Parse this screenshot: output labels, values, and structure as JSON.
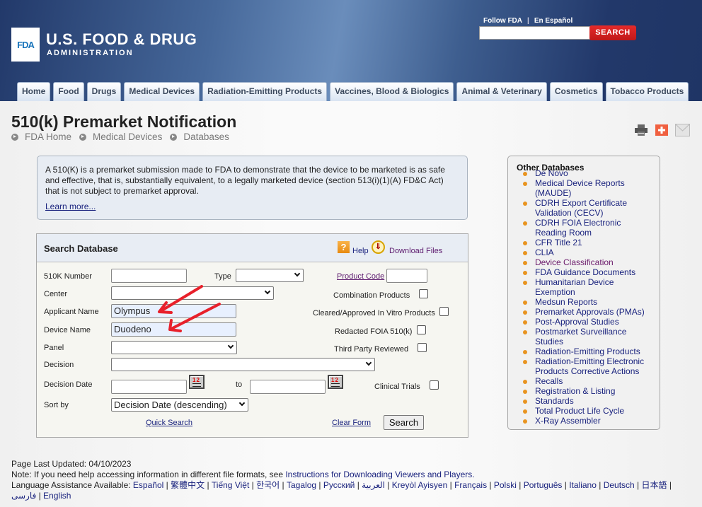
{
  "header": {
    "logo_mark": "FDA",
    "logo_title": "U.S. FOOD & DRUG",
    "logo_subtitle": "ADMINISTRATION",
    "top_links": [
      "Follow FDA",
      "En Español"
    ],
    "search_placeholder": "",
    "search_button": "SEARCH"
  },
  "nav_tabs": [
    "Home",
    "Food",
    "Drugs",
    "Medical Devices",
    "Radiation-Emitting Products",
    "Vaccines, Blood & Biologics",
    "Animal & Veterinary",
    "Cosmetics",
    "Tobacco Products"
  ],
  "page": {
    "title": "510(k) Premarket Notification",
    "breadcrumb": [
      "FDA Home",
      "Medical Devices",
      "Databases"
    ],
    "utility_icons": [
      "print-icon",
      "add-share-icon",
      "email-icon"
    ]
  },
  "intro": {
    "text": "A 510(K) is a premarket submission made to FDA to demonstrate that the device to be marketed is as safe and effective, that is, substantially equivalent, to a legally marketed device (section 513(i)(1)(A) FD&C Act) that is not subject to premarket approval.",
    "learn_more": "Learn more..."
  },
  "search_form": {
    "title": "Search Database",
    "help": "Help",
    "download": "Download Files",
    "labels": {
      "number": "510K Number",
      "type": "Type",
      "product_code": "Product Code",
      "center": "Center",
      "combination": "Combination Products",
      "applicant": "Applicant Name",
      "in_vitro": "Cleared/Approved In Vitro Products",
      "device": "Device Name",
      "redacted": "Redacted FOIA 510(k)",
      "panel": "Panel",
      "third_party": "Third Party Reviewed",
      "decision": "Decision",
      "decision_date": "Decision Date",
      "to": "to",
      "clinical": "Clinical Trials",
      "sort_by": "Sort by"
    },
    "values": {
      "number": "",
      "type": "",
      "product_code": "",
      "center": "",
      "applicant": "Olympus",
      "device": "Duodeno",
      "panel": "",
      "decision": "",
      "date_from": "",
      "date_to": "",
      "sort_by": "Decision Date (descending)"
    },
    "checkboxes": {
      "combination": false,
      "in_vitro": false,
      "redacted": false,
      "third_party": false,
      "clinical": false
    },
    "quick_search": "Quick Search",
    "clear_form": "Clear Form",
    "search_button": "Search"
  },
  "other_databases": {
    "title": "Other Databases",
    "items": [
      {
        "label": "De Novo",
        "visited": false
      },
      {
        "label": "Medical Device Reports (MAUDE)",
        "visited": false
      },
      {
        "label": "CDRH Export Certificate Validation (CECV)",
        "visited": false
      },
      {
        "label": "CDRH FOIA Electronic Reading Room",
        "visited": false
      },
      {
        "label": "CFR Title 21",
        "visited": false
      },
      {
        "label": "CLIA",
        "visited": false
      },
      {
        "label": "Device Classification",
        "visited": true
      },
      {
        "label": "FDA Guidance Documents",
        "visited": false
      },
      {
        "label": "Humanitarian Device Exemption",
        "visited": false
      },
      {
        "label": "Medsun Reports",
        "visited": false
      },
      {
        "label": "Premarket Approvals (PMAs)",
        "visited": false
      },
      {
        "label": "Post-Approval Studies",
        "visited": false
      },
      {
        "label": "Postmarket Surveillance Studies",
        "visited": false
      },
      {
        "label": "Radiation-Emitting Products",
        "visited": false
      },
      {
        "label": "Radiation-Emitting Electronic Products Corrective Actions",
        "visited": false
      },
      {
        "label": "Recalls",
        "visited": false
      },
      {
        "label": "Registration & Listing",
        "visited": false
      },
      {
        "label": "Standards",
        "visited": false
      },
      {
        "label": "Total Product Life Cycle",
        "visited": false
      },
      {
        "label": "X-Ray Assembler",
        "visited": false
      }
    ]
  },
  "footer": {
    "updated": "Page Last Updated: 04/10/2023",
    "note_prefix": "Note: If you need help accessing information in different file formats, see ",
    "note_link": "Instructions for Downloading Viewers and Players.",
    "lang_prefix": "Language Assistance Available: ",
    "languages": [
      "Español",
      "繁體中文",
      "Tiếng Việt",
      "한국어",
      "Tagalog",
      "Русский",
      "العربية",
      "Kreyòl Ayisyen",
      "Français",
      "Polski",
      "Português",
      "Italiano",
      "Deutsch",
      "日本語",
      "فارسی",
      "English"
    ]
  },
  "colors": {
    "header_dark": "#22386a",
    "search_red": "#d32020",
    "link_blue": "#1a237e",
    "bullet_orange": "#e89420",
    "annotation_red": "#e8202a"
  }
}
